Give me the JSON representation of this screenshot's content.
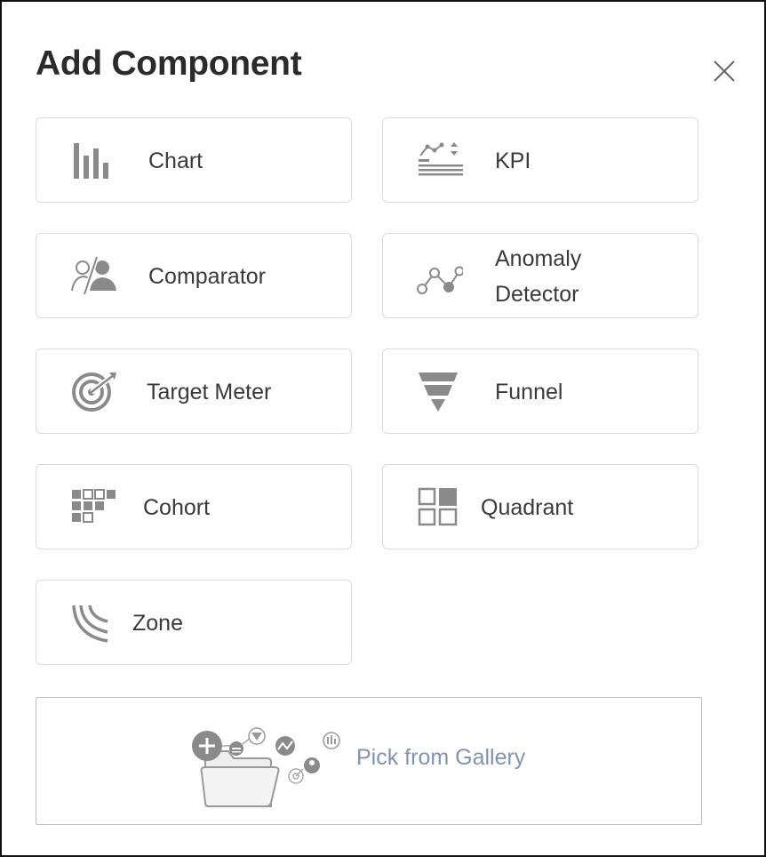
{
  "dialog": {
    "title": "Add Component",
    "close_label": "Close"
  },
  "components": [
    {
      "key": "chart",
      "label": "Chart",
      "icon": "bar-chart-icon"
    },
    {
      "key": "kpi",
      "label": "KPI",
      "icon": "kpi-icon"
    },
    {
      "key": "comparator",
      "label": "Comparator",
      "icon": "comparator-icon"
    },
    {
      "key": "anomaly",
      "label": "Anomaly Detector",
      "icon": "anomaly-line-icon"
    },
    {
      "key": "target",
      "label": "Target Meter",
      "icon": "target-icon"
    },
    {
      "key": "funnel",
      "label": "Funnel",
      "icon": "funnel-icon"
    },
    {
      "key": "cohort",
      "label": "Cohort",
      "icon": "cohort-grid-icon"
    },
    {
      "key": "quadrant",
      "label": "Quadrant",
      "icon": "quadrant-icon"
    },
    {
      "key": "zone",
      "label": "Zone",
      "icon": "zone-arcs-icon"
    }
  ],
  "gallery": {
    "label": "Pick from Gallery",
    "icon": "gallery-folder-icon"
  },
  "colors": {
    "icon_gray": "#8a8a8a",
    "card_border": "#d6dde6",
    "gallery_text": "#8193ad"
  }
}
